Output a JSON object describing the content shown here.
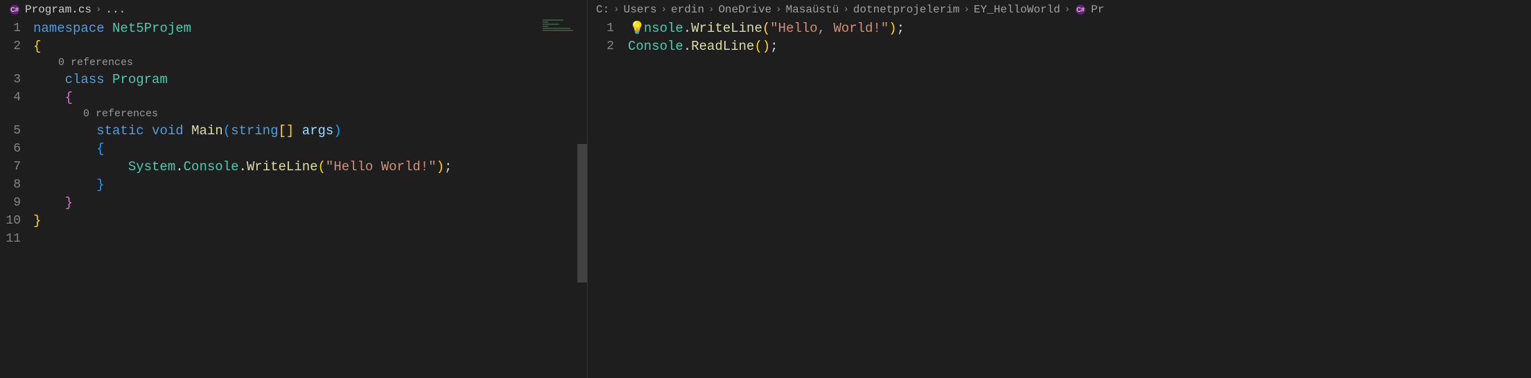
{
  "left": {
    "breadcrumb": {
      "file": "Program.cs",
      "more": "..."
    },
    "codelens": {
      "class": "0 references",
      "main": "0 references"
    },
    "code": {
      "l1": {
        "ns": "namespace",
        "name": "Net5Projem"
      },
      "l2": "{",
      "l3": {
        "kw": "class",
        "name": "Program"
      },
      "l4": "{",
      "l5": {
        "static": "static",
        "void": "void",
        "main": "Main",
        "stringType": "string",
        "args": "args"
      },
      "l6": "{",
      "l7": {
        "system": "System",
        "console": "Console",
        "writeline": "WriteLine",
        "str": "\"Hello World!\""
      },
      "l8": "}",
      "l9": "}",
      "l10": "}"
    },
    "line_numbers": [
      "1",
      "2",
      "3",
      "4",
      "5",
      "6",
      "7",
      "8",
      "9",
      "10",
      "11"
    ]
  },
  "right": {
    "breadcrumb": [
      "C:",
      "Users",
      "erdin",
      "OneDrive",
      "Masaüstü",
      "dotnetprojelerim",
      "EY_HelloWorld",
      "Pr"
    ],
    "code": {
      "l1": {
        "console_tail": "nsole",
        "writeline": "WriteLine",
        "str": "\"Hello, World!\""
      },
      "l2": {
        "console": "Console",
        "readline": "ReadLine"
      }
    },
    "line_numbers": [
      "1",
      "2"
    ]
  }
}
